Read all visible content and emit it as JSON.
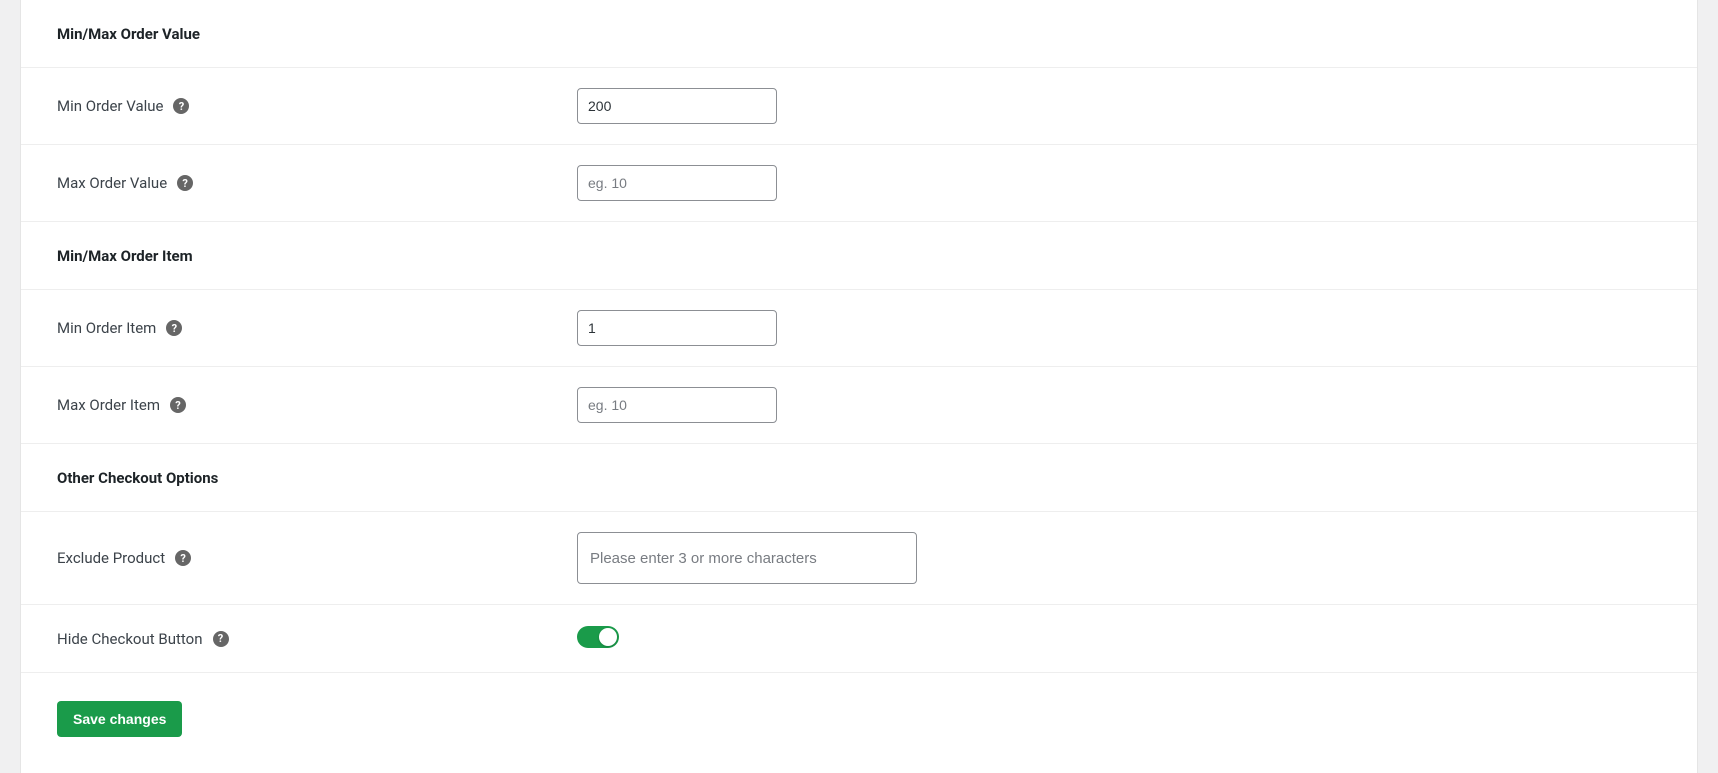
{
  "sections": {
    "order_value": {
      "heading": "Min/Max Order Value",
      "min": {
        "label": "Min Order Value",
        "value": "200",
        "placeholder": ""
      },
      "max": {
        "label": "Max Order Value",
        "value": "",
        "placeholder": "eg. 10"
      }
    },
    "order_item": {
      "heading": "Min/Max Order Item",
      "min": {
        "label": "Min Order Item",
        "value": "1",
        "placeholder": ""
      },
      "max": {
        "label": "Max Order Item",
        "value": "",
        "placeholder": "eg. 10"
      }
    },
    "other": {
      "heading": "Other Checkout Options",
      "exclude": {
        "label": "Exclude Product",
        "value": "",
        "placeholder": "Please enter 3 or more characters"
      },
      "hide_checkout": {
        "label": "Hide Checkout Button",
        "on": true
      }
    }
  },
  "actions": {
    "save": "Save changes"
  },
  "help_glyph": "?"
}
